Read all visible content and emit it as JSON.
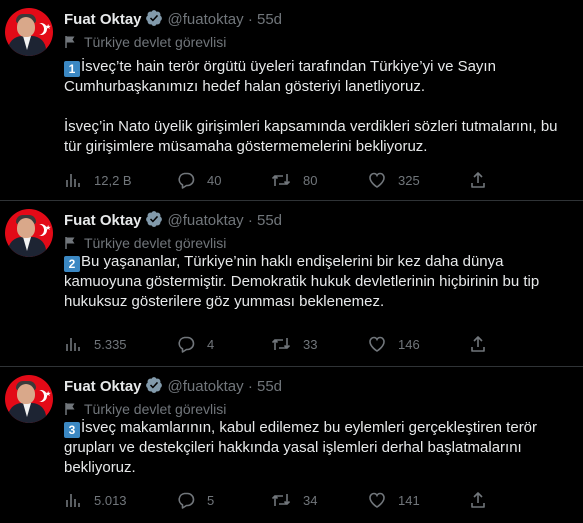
{
  "colors": {
    "background": "#000000",
    "text": "#e7e9ea",
    "muted": "#71767b",
    "verified": "#829aab",
    "badge": "#3b88c3"
  },
  "tweets": [
    {
      "author": {
        "name": "Fuat Oktay",
        "handle": "@fuatoktay"
      },
      "separator": "·",
      "time": "55d",
      "label": "Türkiye devlet görevlisi",
      "badge": "1",
      "lines": [
        "İsveç’te hain terör örgütü üyeleri tarafından Türkiye’yi ve Sayın Cumhurbaşkanımızı hedef halan gösteriyi lanetliyoruz.",
        "İsveç’in Nato üyelik girişimleri kapsamında verdikleri sözleri tutmalarını, bu tür girişimlere müsamaha göstermemelerini bekliyoruz."
      ],
      "stats": {
        "views": "12,2 B",
        "replies": "40",
        "retweets": "80",
        "likes": "325"
      }
    },
    {
      "author": {
        "name": "Fuat Oktay",
        "handle": "@fuatoktay"
      },
      "separator": "·",
      "time": "55d",
      "label": "Türkiye devlet görevlisi",
      "badge": "2",
      "lines": [
        "Bu yaşananlar, Türkiye’nin haklı endişelerini bir kez daha dünya kamuoyuna göstermiştir. Demokratik hukuk devletlerinin hiçbirinin bu tip hukuksuz gösterilere göz yumması beklenemez."
      ],
      "stats": {
        "views": "5.335",
        "replies": "4",
        "retweets": "33",
        "likes": "146"
      }
    },
    {
      "author": {
        "name": "Fuat Oktay",
        "handle": "@fuatoktay"
      },
      "separator": "·",
      "time": "55d",
      "label": "Türkiye devlet görevlisi",
      "badge": "3",
      "lines": [
        "İsveç makamlarının, kabul edilemez bu eylemleri gerçekleştiren terör grupları ve destekçileri hakkında yasal işlemleri derhal başlatmalarını bekliyoruz."
      ],
      "stats": {
        "views": "5.013",
        "replies": "5",
        "retweets": "34",
        "likes": "141"
      }
    }
  ]
}
